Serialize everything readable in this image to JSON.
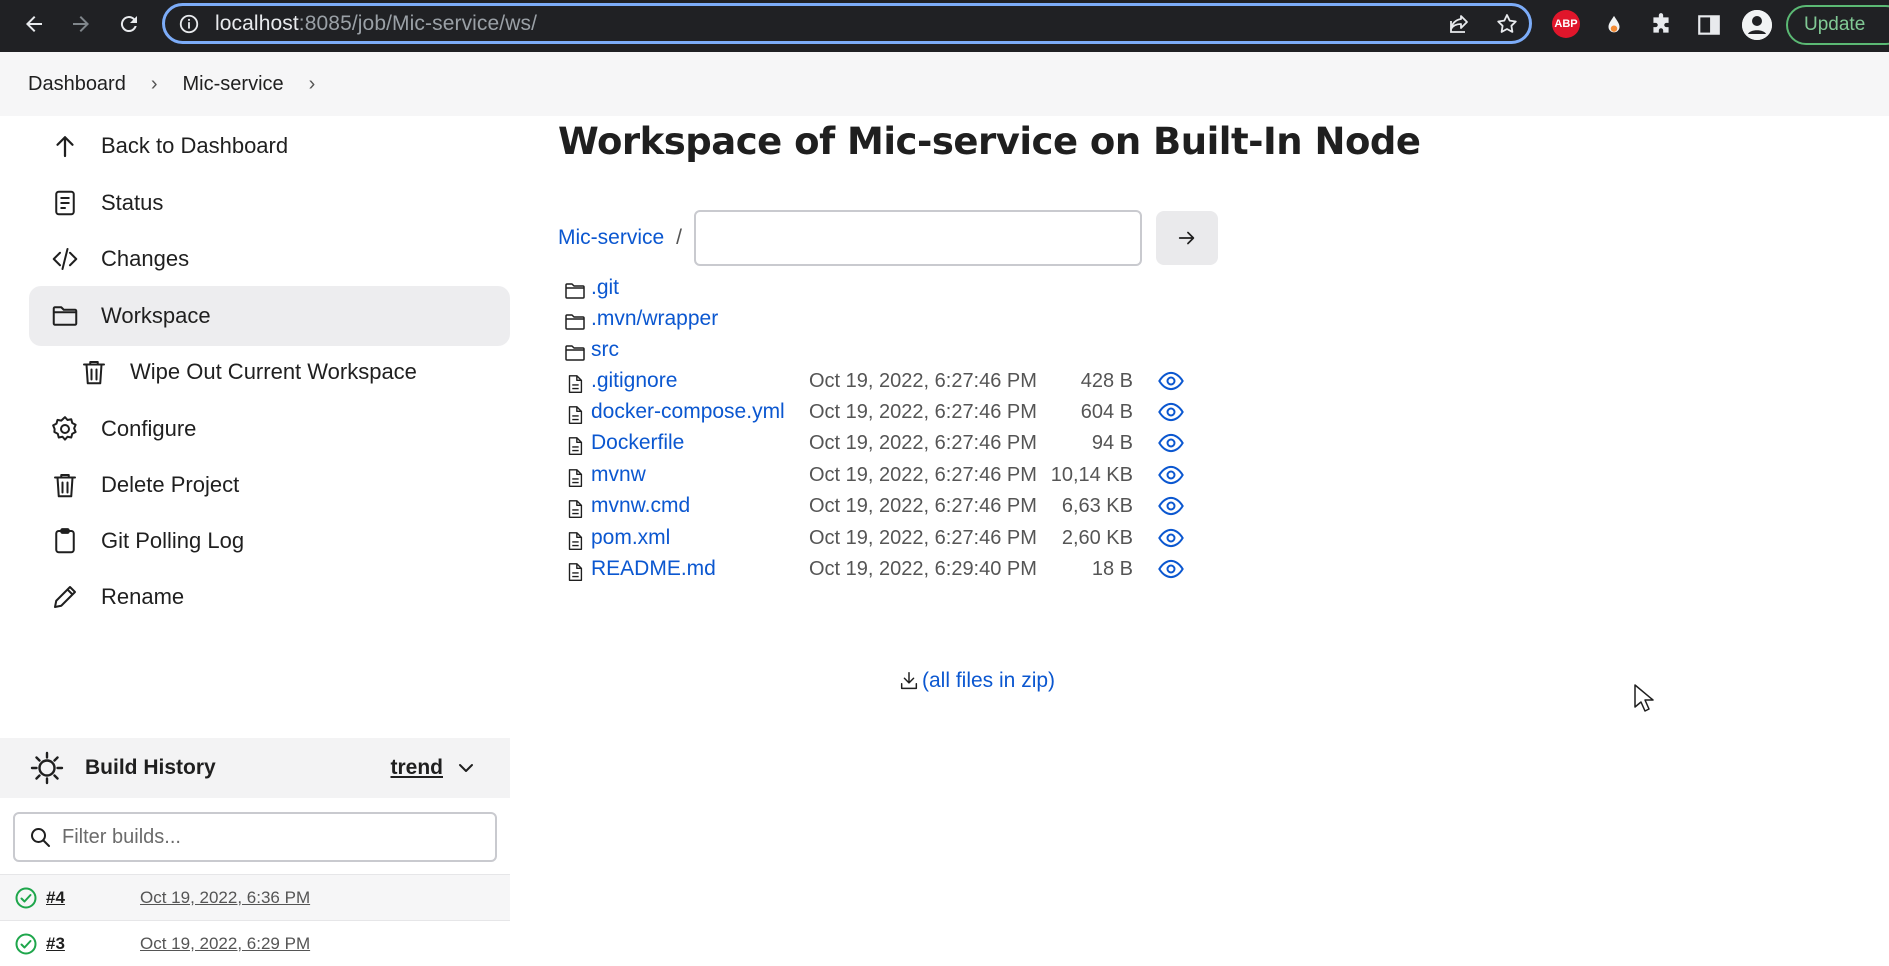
{
  "browser": {
    "url_host": "localhost",
    "url_rest": ":8085/job/Mic-service/ws/",
    "update_label": "Update",
    "abp_label": "ABP"
  },
  "breadcrumb": [
    "Dashboard",
    "Mic-service"
  ],
  "sidebar": {
    "items": [
      {
        "label": "Back to Dashboard",
        "icon": "arrow-up-icon"
      },
      {
        "label": "Status",
        "icon": "document-icon"
      },
      {
        "label": "Changes",
        "icon": "code-icon"
      },
      {
        "label": "Workspace",
        "icon": "folder-icon"
      },
      {
        "label": "Wipe Out Current Workspace",
        "icon": "trash-icon"
      },
      {
        "label": "Configure",
        "icon": "gear-icon"
      },
      {
        "label": "Delete Project",
        "icon": "trash-icon"
      },
      {
        "label": "Git Polling Log",
        "icon": "clipboard-icon"
      },
      {
        "label": "Rename",
        "icon": "pencil-icon"
      }
    ],
    "build_history": {
      "title": "Build History",
      "trend_label": "trend",
      "filter_placeholder": "Filter builds...",
      "builds": [
        {
          "number": "#4",
          "time": "Oct 19, 2022, 6:36 PM",
          "status": "success"
        },
        {
          "number": "#3",
          "time": "Oct 19, 2022, 6:29 PM",
          "status": "success"
        }
      ]
    }
  },
  "main": {
    "title": "Workspace of Mic-service on Built-In Node",
    "path_root": "Mic-service",
    "path_sep": "/",
    "folders": [
      ".git",
      ".mvn/wrapper",
      "src"
    ],
    "files": [
      {
        "name": ".gitignore",
        "date": "Oct 19, 2022, 6:27:46 PM",
        "size": "428 B"
      },
      {
        "name": "docker-compose.yml",
        "date": "Oct 19, 2022, 6:27:46 PM",
        "size": "604 B"
      },
      {
        "name": "Dockerfile",
        "date": "Oct 19, 2022, 6:27:46 PM",
        "size": "94 B"
      },
      {
        "name": "mvnw",
        "date": "Oct 19, 2022, 6:27:46 PM",
        "size": "10,14 KB"
      },
      {
        "name": "mvnw.cmd",
        "date": "Oct 19, 2022, 6:27:46 PM",
        "size": "6,63 KB"
      },
      {
        "name": "pom.xml",
        "date": "Oct 19, 2022, 6:27:46 PM",
        "size": "2,60 KB"
      },
      {
        "name": "README.md",
        "date": "Oct 19, 2022, 6:29:40 PM",
        "size": "18 B"
      }
    ],
    "zip_label": "(all files in zip)"
  }
}
